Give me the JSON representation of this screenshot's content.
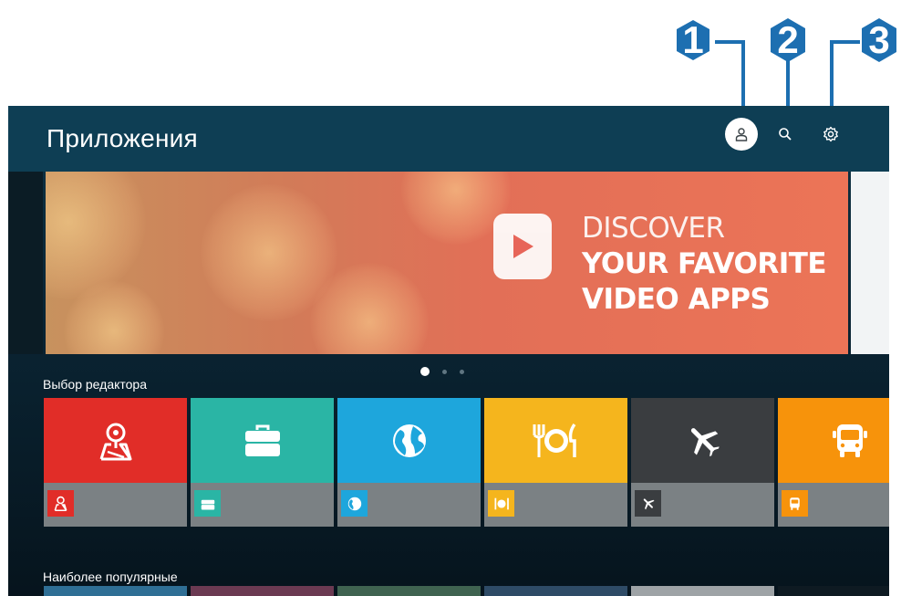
{
  "callouts": [
    "1",
    "2",
    "3"
  ],
  "header": {
    "title": "Приложения",
    "buttons": [
      {
        "id": "account",
        "icon": "person-icon"
      },
      {
        "id": "search",
        "icon": "search-icon"
      },
      {
        "id": "settings",
        "icon": "gear-icon"
      }
    ]
  },
  "banner": {
    "line1": "DISCOVER",
    "line2": "YOUR FAVORITE",
    "line3": "VIDEO APPS",
    "icon": "play-icon",
    "page_indicator": {
      "count": 3,
      "active": 0
    }
  },
  "editors_choice": {
    "title": "Выбор редактора",
    "tiles": [
      {
        "icon": "map-pin-icon",
        "color": "#e12d28"
      },
      {
        "icon": "briefcase-icon",
        "color": "#2ab5a5"
      },
      {
        "icon": "globe-icon",
        "color": "#1ea6dc"
      },
      {
        "icon": "dining-icon",
        "color": "#f5b51d"
      },
      {
        "icon": "airplane-icon",
        "color": "#3a3d40"
      },
      {
        "icon": "bus-icon",
        "color": "#f7930b"
      }
    ]
  },
  "most_popular": {
    "title": "Наиболее популярные",
    "tile_colors": [
      "#2f6f95",
      "#6b3a52",
      "#3f6350",
      "#2e4b66",
      "#9ea3a6",
      "#0e1a22"
    ]
  },
  "colors": {
    "callout": "#1d6fb1",
    "header": "#0e3e54"
  }
}
